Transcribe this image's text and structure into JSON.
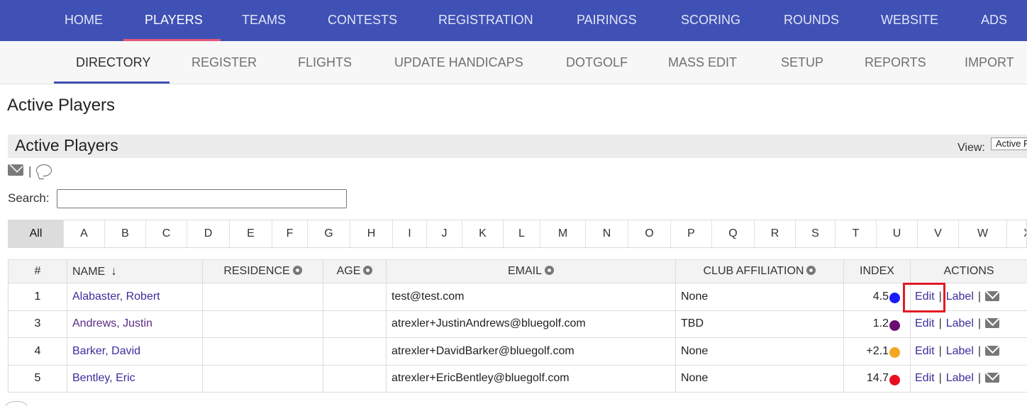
{
  "top_nav": {
    "items": [
      {
        "label": "HOME"
      },
      {
        "label": "PLAYERS"
      },
      {
        "label": "TEAMS"
      },
      {
        "label": "CONTESTS"
      },
      {
        "label": "REGISTRATION"
      },
      {
        "label": "PAIRINGS"
      },
      {
        "label": "SCORING"
      },
      {
        "label": "ROUNDS"
      },
      {
        "label": "WEBSITE"
      },
      {
        "label": "ADS"
      }
    ],
    "active": "PLAYERS",
    "bg_color": "#3f51b5"
  },
  "sub_nav": {
    "items": [
      {
        "label": "DIRECTORY"
      },
      {
        "label": "REGISTER"
      },
      {
        "label": "FLIGHTS"
      },
      {
        "label": "UPDATE HANDICAPS"
      },
      {
        "label": "DOTGOLF"
      },
      {
        "label": "MASS EDIT"
      },
      {
        "label": "SETUP"
      },
      {
        "label": "REPORTS"
      },
      {
        "label": "IMPORT"
      }
    ],
    "active": "DIRECTORY"
  },
  "page_title": "Active Players",
  "section": {
    "title": "Active Players",
    "view_label": "View:",
    "view_value": "Active Players"
  },
  "icons": {
    "email": "envelope-icon",
    "chat": "chat-bubble-icon",
    "pipe": "|"
  },
  "search": {
    "label": "Search:",
    "value": "",
    "placeholder": ""
  },
  "alphabet": {
    "all_label": "All",
    "letters": [
      "A",
      "B",
      "C",
      "D",
      "E",
      "F",
      "G",
      "H",
      "I",
      "J",
      "K",
      "L",
      "M",
      "N",
      "O",
      "P",
      "Q",
      "R",
      "S",
      "T",
      "U",
      "V",
      "W",
      "X"
    ],
    "active": "All"
  },
  "table": {
    "headers": {
      "num": "#",
      "name": "NAME",
      "residence": "RESIDENCE",
      "age": "AGE",
      "email": "EMAIL",
      "club": "CLUB AFFILIATION",
      "index": "INDEX",
      "actions": "ACTIONS"
    },
    "rows": [
      {
        "num": "1",
        "name": "Alabaster, Robert",
        "residence": "",
        "age": "",
        "email": "test@test.com",
        "club": "None",
        "index": "4.5",
        "dot_color": "#1a1aff",
        "edit": "Edit",
        "label": "Label"
      },
      {
        "num": "3",
        "name": "Andrews, Justin",
        "residence": "",
        "age": "",
        "email": "atrexler+JustinAndrews@bluegolf.com",
        "club": "TBD",
        "index": "1.2",
        "dot_color": "#6a0e73",
        "edit": "Edit",
        "label": "Label"
      },
      {
        "num": "4",
        "name": "Barker, David",
        "residence": "",
        "age": "",
        "email": "atrexler+DavidBarker@bluegolf.com",
        "club": "None",
        "index": "+2.1",
        "dot_color": "#f5a623",
        "edit": "Edit",
        "label": "Label"
      },
      {
        "num": "5",
        "name": "Bentley, Eric",
        "residence": "",
        "age": "",
        "email": "atrexler+EricBentley@bluegolf.com",
        "club": "None",
        "index": "14.7",
        "dot_color": "#e8101f",
        "edit": "Edit",
        "label": "Label"
      }
    ],
    "separator": "|"
  },
  "highlight_color": "#e01b24"
}
